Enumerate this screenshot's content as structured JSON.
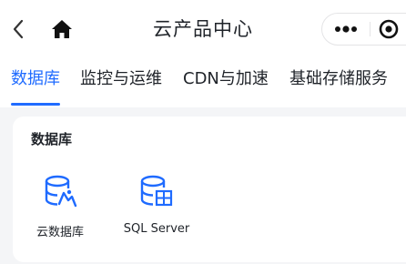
{
  "header": {
    "title": "云产品中心",
    "back_icon": "chevron-left-icon",
    "home_icon": "home-icon",
    "more_icon": "more-dots-icon",
    "close_icon": "target-circle-icon"
  },
  "tabs": [
    {
      "label": "数据库",
      "active": true
    },
    {
      "label": "监控与运维",
      "active": false
    },
    {
      "label": "CDN与加速",
      "active": false
    },
    {
      "label": "基础存储服务",
      "active": false
    }
  ],
  "section": {
    "title": "数据库",
    "products": [
      {
        "label": "云数据库",
        "icon": "cloud-database-icon"
      },
      {
        "label": "SQL Server",
        "icon": "sql-server-icon"
      }
    ]
  },
  "colors": {
    "accent": "#1f6bff",
    "text": "#1f2329",
    "background": "#f4f5f7",
    "card": "#ffffff"
  }
}
